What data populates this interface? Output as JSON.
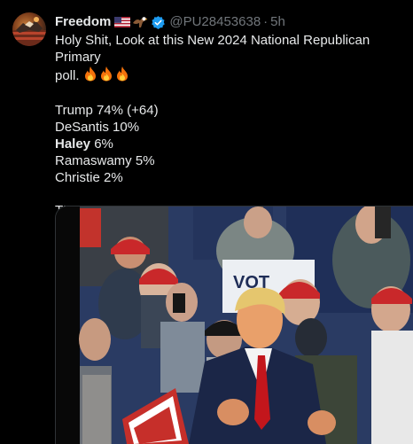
{
  "author": {
    "name": "Freedom",
    "handle": "@PU28453638",
    "separator": "·",
    "time": "5h",
    "avatar_icon": "eagle-flag-avatar",
    "badge_icons": [
      "us-flag-icon",
      "eagle-icon"
    ],
    "verified_icon": "verified-badge-icon",
    "verified_color": "#1d9bf0"
  },
  "tweet": {
    "line1": "Holy Shit, Look at this New 2024 National Republican Primary",
    "line2": "poll.",
    "fire_icons": [
      "fire-icon",
      "fire-icon",
      "fire-icon"
    ],
    "poll": [
      {
        "text": "Trump 74% (+64)",
        "bold": false
      },
      {
        "text": "DeSantis 10%",
        "bold": false
      },
      {
        "text_name": "Haley",
        "text_value": " 6%",
        "bold": true
      },
      {
        "text": "Ramaswamy 5%",
        "bold": false
      },
      {
        "text": "Christie 2%",
        "bold": false
      }
    ],
    "closing": "THE  BEST IS  YET TO COME!"
  },
  "media": {
    "sign_text": "VOT",
    "description_icon": "video-thumbnail"
  },
  "colors": {
    "background": "#000000",
    "text": "#e7e9ea",
    "muted": "#71767b",
    "border": "#2f3336"
  }
}
